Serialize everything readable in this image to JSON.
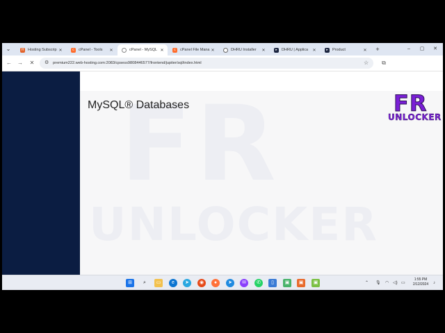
{
  "browser": {
    "tabs": [
      {
        "label": "Hosting Subscrip",
        "favicon": "hosting-favicon",
        "color": "#e2632b"
      },
      {
        "label": "cPanel - Tools",
        "favicon": "cpanel-favicon",
        "color": "#ff6c2c"
      },
      {
        "label": "cPanel - MySQL",
        "favicon": "loading-favicon",
        "color": "#555555"
      },
      {
        "label": "cPanel File Mana",
        "favicon": "cpanel-favicon",
        "color": "#ff6c2c"
      },
      {
        "label": "DHRU Installer",
        "favicon": "globe-favicon",
        "color": "#555555"
      },
      {
        "label": "DHRU | Applica",
        "favicon": "dhru-favicon",
        "color": "#1b2540"
      },
      {
        "label": "Product",
        "favicon": "dhru-favicon",
        "color": "#1b2540"
      }
    ],
    "active_tab_index": 2,
    "url": "premium222.web-hosting.com:2083/cpsess9808446577/frontend/jupiter/sql/index.html"
  },
  "page": {
    "title": "MySQL® Databases"
  },
  "watermark": {
    "big": "FR",
    "small": "UNLOCKER"
  },
  "logo": {
    "line1": "FR",
    "line2": "UNLOCKER"
  },
  "taskbar": {
    "time": "1:55 PM",
    "date": "2/12/2024",
    "badges": {
      "messenger": "2",
      "whatsapp": "1"
    }
  },
  "colors": {
    "sidebar": "#0b1d42",
    "tabstrip": "#dfe6f2",
    "logo": "#7a1fd6"
  }
}
